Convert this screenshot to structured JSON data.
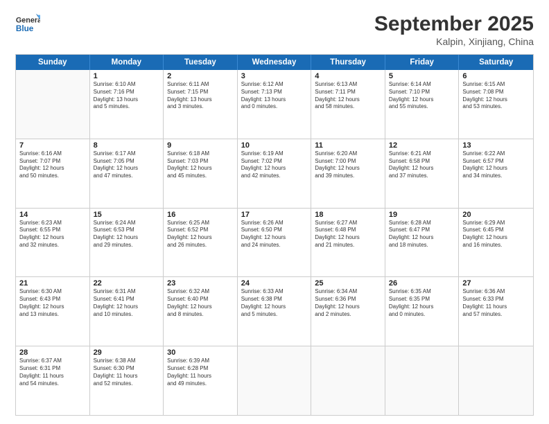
{
  "logo": {
    "line1": "General",
    "line2": "Blue"
  },
  "title": "September 2025",
  "subtitle": "Kalpin, Xinjiang, China",
  "days": [
    "Sunday",
    "Monday",
    "Tuesday",
    "Wednesday",
    "Thursday",
    "Friday",
    "Saturday"
  ],
  "weeks": [
    [
      {
        "day": "",
        "data": ""
      },
      {
        "day": "1",
        "data": "Sunrise: 6:10 AM\nSunset: 7:16 PM\nDaylight: 13 hours\nand 5 minutes."
      },
      {
        "day": "2",
        "data": "Sunrise: 6:11 AM\nSunset: 7:15 PM\nDaylight: 13 hours\nand 3 minutes."
      },
      {
        "day": "3",
        "data": "Sunrise: 6:12 AM\nSunset: 7:13 PM\nDaylight: 13 hours\nand 0 minutes."
      },
      {
        "day": "4",
        "data": "Sunrise: 6:13 AM\nSunset: 7:11 PM\nDaylight: 12 hours\nand 58 minutes."
      },
      {
        "day": "5",
        "data": "Sunrise: 6:14 AM\nSunset: 7:10 PM\nDaylight: 12 hours\nand 55 minutes."
      },
      {
        "day": "6",
        "data": "Sunrise: 6:15 AM\nSunset: 7:08 PM\nDaylight: 12 hours\nand 53 minutes."
      }
    ],
    [
      {
        "day": "7",
        "data": "Sunrise: 6:16 AM\nSunset: 7:07 PM\nDaylight: 12 hours\nand 50 minutes."
      },
      {
        "day": "8",
        "data": "Sunrise: 6:17 AM\nSunset: 7:05 PM\nDaylight: 12 hours\nand 47 minutes."
      },
      {
        "day": "9",
        "data": "Sunrise: 6:18 AM\nSunset: 7:03 PM\nDaylight: 12 hours\nand 45 minutes."
      },
      {
        "day": "10",
        "data": "Sunrise: 6:19 AM\nSunset: 7:02 PM\nDaylight: 12 hours\nand 42 minutes."
      },
      {
        "day": "11",
        "data": "Sunrise: 6:20 AM\nSunset: 7:00 PM\nDaylight: 12 hours\nand 39 minutes."
      },
      {
        "day": "12",
        "data": "Sunrise: 6:21 AM\nSunset: 6:58 PM\nDaylight: 12 hours\nand 37 minutes."
      },
      {
        "day": "13",
        "data": "Sunrise: 6:22 AM\nSunset: 6:57 PM\nDaylight: 12 hours\nand 34 minutes."
      }
    ],
    [
      {
        "day": "14",
        "data": "Sunrise: 6:23 AM\nSunset: 6:55 PM\nDaylight: 12 hours\nand 32 minutes."
      },
      {
        "day": "15",
        "data": "Sunrise: 6:24 AM\nSunset: 6:53 PM\nDaylight: 12 hours\nand 29 minutes."
      },
      {
        "day": "16",
        "data": "Sunrise: 6:25 AM\nSunset: 6:52 PM\nDaylight: 12 hours\nand 26 minutes."
      },
      {
        "day": "17",
        "data": "Sunrise: 6:26 AM\nSunset: 6:50 PM\nDaylight: 12 hours\nand 24 minutes."
      },
      {
        "day": "18",
        "data": "Sunrise: 6:27 AM\nSunset: 6:48 PM\nDaylight: 12 hours\nand 21 minutes."
      },
      {
        "day": "19",
        "data": "Sunrise: 6:28 AM\nSunset: 6:47 PM\nDaylight: 12 hours\nand 18 minutes."
      },
      {
        "day": "20",
        "data": "Sunrise: 6:29 AM\nSunset: 6:45 PM\nDaylight: 12 hours\nand 16 minutes."
      }
    ],
    [
      {
        "day": "21",
        "data": "Sunrise: 6:30 AM\nSunset: 6:43 PM\nDaylight: 12 hours\nand 13 minutes."
      },
      {
        "day": "22",
        "data": "Sunrise: 6:31 AM\nSunset: 6:41 PM\nDaylight: 12 hours\nand 10 minutes."
      },
      {
        "day": "23",
        "data": "Sunrise: 6:32 AM\nSunset: 6:40 PM\nDaylight: 12 hours\nand 8 minutes."
      },
      {
        "day": "24",
        "data": "Sunrise: 6:33 AM\nSunset: 6:38 PM\nDaylight: 12 hours\nand 5 minutes."
      },
      {
        "day": "25",
        "data": "Sunrise: 6:34 AM\nSunset: 6:36 PM\nDaylight: 12 hours\nand 2 minutes."
      },
      {
        "day": "26",
        "data": "Sunrise: 6:35 AM\nSunset: 6:35 PM\nDaylight: 12 hours\nand 0 minutes."
      },
      {
        "day": "27",
        "data": "Sunrise: 6:36 AM\nSunset: 6:33 PM\nDaylight: 11 hours\nand 57 minutes."
      }
    ],
    [
      {
        "day": "28",
        "data": "Sunrise: 6:37 AM\nSunset: 6:31 PM\nDaylight: 11 hours\nand 54 minutes."
      },
      {
        "day": "29",
        "data": "Sunrise: 6:38 AM\nSunset: 6:30 PM\nDaylight: 11 hours\nand 52 minutes."
      },
      {
        "day": "30",
        "data": "Sunrise: 6:39 AM\nSunset: 6:28 PM\nDaylight: 11 hours\nand 49 minutes."
      },
      {
        "day": "",
        "data": ""
      },
      {
        "day": "",
        "data": ""
      },
      {
        "day": "",
        "data": ""
      },
      {
        "day": "",
        "data": ""
      }
    ]
  ]
}
